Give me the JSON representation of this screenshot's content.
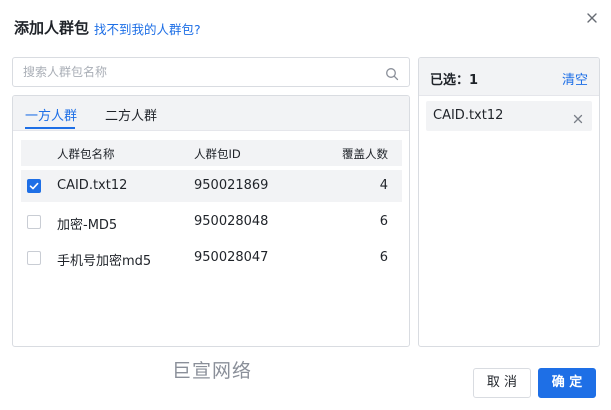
{
  "dialog": {
    "title": "添加人群包",
    "help_link": "找不到我的人群包?"
  },
  "search": {
    "placeholder": "搜索人群包名称",
    "value": ""
  },
  "tabs": [
    {
      "label": "一方人群",
      "active": true
    },
    {
      "label": "二方人群",
      "active": false
    }
  ],
  "table": {
    "columns": [
      "人群包名称",
      "人群包ID",
      "覆盖人数"
    ],
    "rows": [
      {
        "name": "CAID.txt12",
        "id": "950021869",
        "count": "4",
        "checked": true
      },
      {
        "name": "加密-MD5",
        "id": "950028048",
        "count": "6",
        "checked": false
      },
      {
        "name": "手机号加密md5",
        "id": "950028047",
        "count": "6",
        "checked": false
      }
    ]
  },
  "selection": {
    "label": "已选：1",
    "clear_label": "清空",
    "items": [
      "CAID.txt12"
    ]
  },
  "watermark": "巨宣网络",
  "footer": {
    "cancel_label": "取 消",
    "ok_label": "确 定"
  },
  "colors": {
    "accent": "#1e6fe6",
    "header_bg": "#f2f3f5",
    "border": "#d9dce1"
  },
  "icons": [
    "close-icon",
    "search-icon",
    "checkmark-icon",
    "remove-icon"
  ]
}
